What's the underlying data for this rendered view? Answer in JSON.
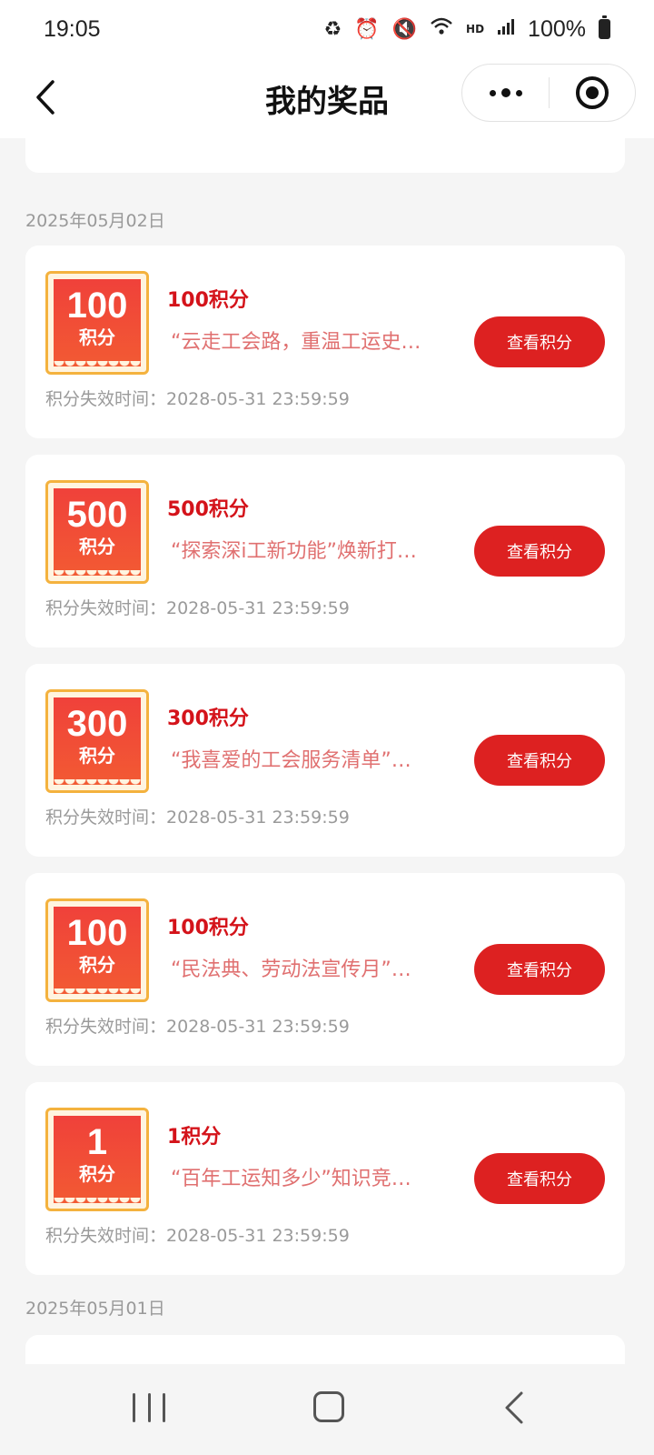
{
  "status_bar": {
    "time": "19:05",
    "hd": "HD",
    "battery": "100%"
  },
  "nav": {
    "title": "我的奖品"
  },
  "sections": [
    {
      "date": "2025年05月02日"
    },
    {
      "date": "2025年05月01日"
    }
  ],
  "prizes": [
    {
      "badge_number": "100",
      "badge_unit": "积分",
      "title": "100积分",
      "desc": "“云走工会路，重温工运史…",
      "expire": "积分失效时间：2028-05-31 23:59:59",
      "button": "查看积分"
    },
    {
      "badge_number": "500",
      "badge_unit": "积分",
      "title": "500积分",
      "desc": "“探索深i工新功能”焕新打…",
      "expire": "积分失效时间：2028-05-31 23:59:59",
      "button": "查看积分"
    },
    {
      "badge_number": "300",
      "badge_unit": "积分",
      "title": "300积分",
      "desc": "“我喜爱的工会服务清单”…",
      "expire": "积分失效时间：2028-05-31 23:59:59",
      "button": "查看积分"
    },
    {
      "badge_number": "100",
      "badge_unit": "积分",
      "title": "100积分",
      "desc": "“民法典、劳动法宣传月”…",
      "expire": "积分失效时间：2028-05-31 23:59:59",
      "button": "查看积分"
    },
    {
      "badge_number": "1",
      "badge_unit": "积分",
      "title": "1积分",
      "desc": "“百年工运知多少”知识竞…",
      "expire": "积分失效时间：2028-05-31 23:59:59",
      "button": "查看积分"
    }
  ],
  "colors": {
    "accent": "#dd2121",
    "title_red": "#d4131a",
    "badge_border": "#f4b23e"
  }
}
